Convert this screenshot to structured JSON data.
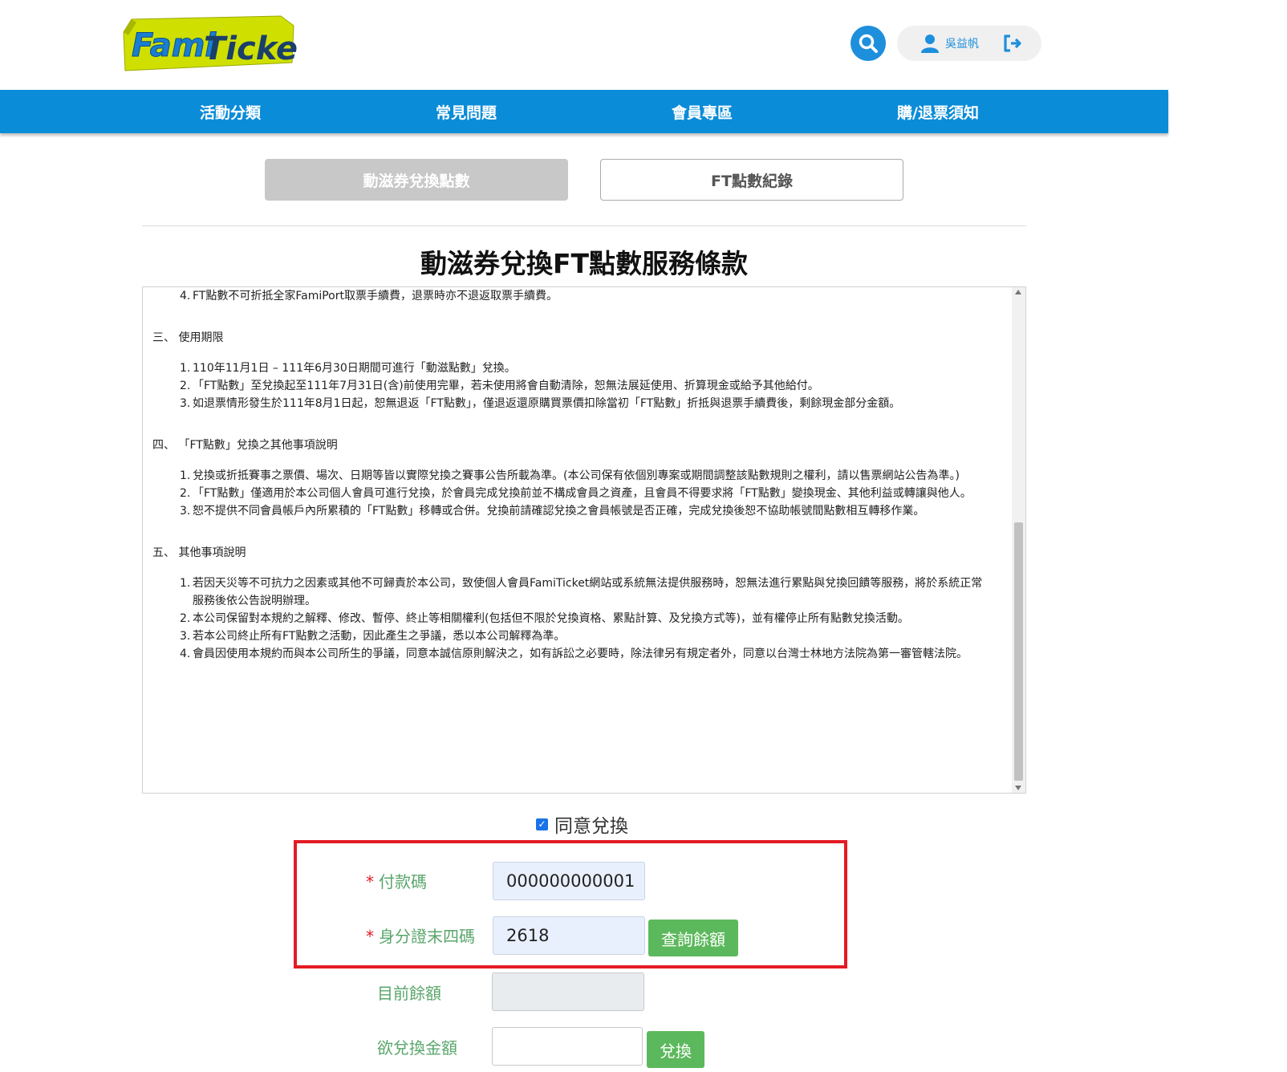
{
  "logo": {
    "part1": "Fami",
    "part2": "Ticket"
  },
  "header": {
    "user_name": "吳益帆"
  },
  "nav": [
    "活動分類",
    "常見問題",
    "會員專區",
    "購/退票須知"
  ],
  "tabs": {
    "active": "動滋券兌換點數",
    "inactive": "FT點數紀錄"
  },
  "terms": {
    "title": "動滋券兌換FT點數服務條款",
    "sections": [
      {
        "head": "",
        "items": [
          {
            "num": "4.",
            "text": "FT點數不可折抵全家FamiPort取票手續費，退票時亦不退返取票手續費。"
          }
        ]
      },
      {
        "head": "三、 使用期限",
        "items": [
          {
            "num": "1.",
            "text": "110年11月1日 – 111年6月30日期間可進行「動滋點數」兌換。"
          },
          {
            "num": "2.",
            "text": "「FT點數」至兌換起至111年7月31日(含)前使用完畢，若未使用將會自動清除，恕無法展延使用、折算現金或給予其他給付。"
          },
          {
            "num": "3.",
            "text": "如退票情形發生於111年8月1日起，恕無退返「FT點數」，僅退返還原購買票價扣除當初「FT點數」折抵與退票手續費後，剩餘現金部分金額。"
          }
        ]
      },
      {
        "head": "四、 「FT點數」兌換之其他事項說明",
        "items": [
          {
            "num": "1.",
            "text": "兌換或折抵賽事之票價、場次、日期等皆以實際兌換之賽事公告所載為準。(本公司保有依個別專案或期間調整該點數規則之權利，請以售票網站公告為準。)"
          },
          {
            "num": "2.",
            "text": "「FT點數」僅適用於本公司個人會員可進行兌換，於會員完成兌換前並不構成會員之資產，且會員不得要求將「FT點數」變換現金、其他利益或轉讓與他人。"
          },
          {
            "num": "3.",
            "text": "恕不提供不同會員帳戶內所累積的「FT點數」移轉或合併。兌換前請確認兌換之會員帳號是否正確，完成兌換後恕不協助帳號間點數相互轉移作業。"
          }
        ]
      },
      {
        "head": "五、 其他事項說明",
        "items": [
          {
            "num": "1.",
            "text": "若因天災等不可抗力之因素或其他不可歸責於本公司，致使個人會員FamiTicket網站或系統無法提供服務時，恕無法進行累點與兌換回饋等服務，將於系統正常服務後依公告說明辦理。"
          },
          {
            "num": "2.",
            "text": "本公司保留對本規約之解釋、修改、暫停、終止等相關權利(包括但不限於兌換資格、累點計算、及兌換方式等)，並有權停止所有點數兌換活動。"
          },
          {
            "num": "3.",
            "text": "若本公司終止所有FT點數之活動，因此產生之爭議，悉以本公司解釋為準。"
          },
          {
            "num": "4.",
            "text": "會員因使用本規約而與本公司所生的爭議，同意本誠信原則解決之，如有訴訟之必要時，除法律另有規定者外，同意以台灣士林地方法院為第一審管轄法院。"
          }
        ]
      }
    ]
  },
  "agree": {
    "label": "同意兌換",
    "checked": true
  },
  "form": {
    "required_mark": "*",
    "payment_code_label": "付款碼",
    "payment_code_value": "000000000001",
    "id_last4_label": "身分證末四碼",
    "id_last4_value": "2618",
    "query_button": "查詢餘額",
    "balance_label": "目前餘額",
    "balance_value": "",
    "amount_label": "欲兌換金額",
    "amount_value": "",
    "exchange_button": "兌換"
  },
  "colors": {
    "brand_blue": "#0a8cd8",
    "green": "#5cb85c",
    "highlight_red": "#e31b23",
    "logo_yellow": "#d4e600"
  }
}
